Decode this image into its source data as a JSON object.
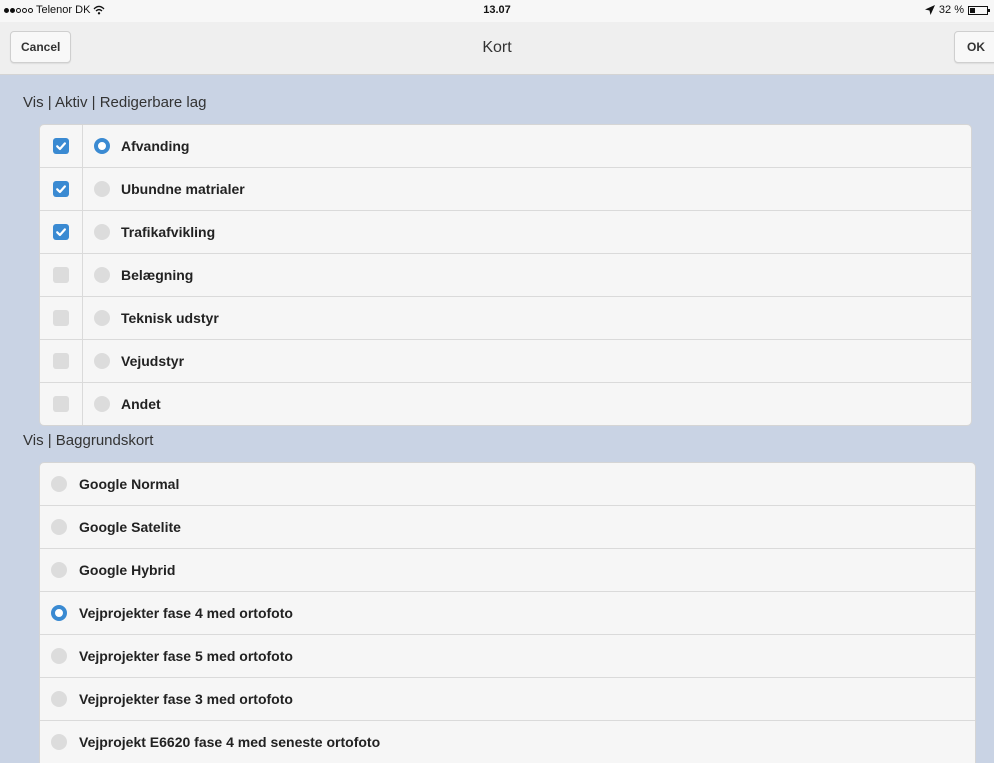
{
  "status_bar": {
    "carrier": "Telenor DK",
    "time": "13.07",
    "battery_percent": "32 %",
    "signal_bars_filled": 2,
    "signal_bars_total": 5
  },
  "nav": {
    "title": "Kort",
    "cancel_label": "Cancel",
    "ok_label": "OK"
  },
  "layers_section": {
    "heading": "Vis | Aktiv | Redigerbare lag",
    "items": [
      {
        "label": "Afvanding",
        "visible": true,
        "active": true
      },
      {
        "label": "Ubundne matrialer",
        "visible": true,
        "active": false
      },
      {
        "label": "Trafikafvikling",
        "visible": true,
        "active": false
      },
      {
        "label": "Belægning",
        "visible": false,
        "active": false
      },
      {
        "label": "Teknisk udstyr",
        "visible": false,
        "active": false
      },
      {
        "label": "Vejudstyr",
        "visible": false,
        "active": false
      },
      {
        "label": "Andet",
        "visible": false,
        "active": false
      }
    ]
  },
  "background_section": {
    "heading": "Vis | Baggrundskort",
    "items": [
      {
        "label": "Google Normal",
        "selected": false
      },
      {
        "label": "Google Satelite",
        "selected": false
      },
      {
        "label": "Google Hybrid",
        "selected": false
      },
      {
        "label": "Vejprojekter fase 4 med ortofoto",
        "selected": true
      },
      {
        "label": "Vejprojekter fase 5 med ortofoto",
        "selected": false
      },
      {
        "label": "Vejprojekter fase 3 med ortofoto",
        "selected": false
      },
      {
        "label": "Vejprojekt E6620 fase 4 med seneste ortofoto",
        "selected": false
      }
    ]
  },
  "colors": {
    "accent": "#3a8ad2",
    "background": "#c9d3e4",
    "row_background": "#f6f6f6",
    "unselected_control": "#dcdcdc"
  }
}
